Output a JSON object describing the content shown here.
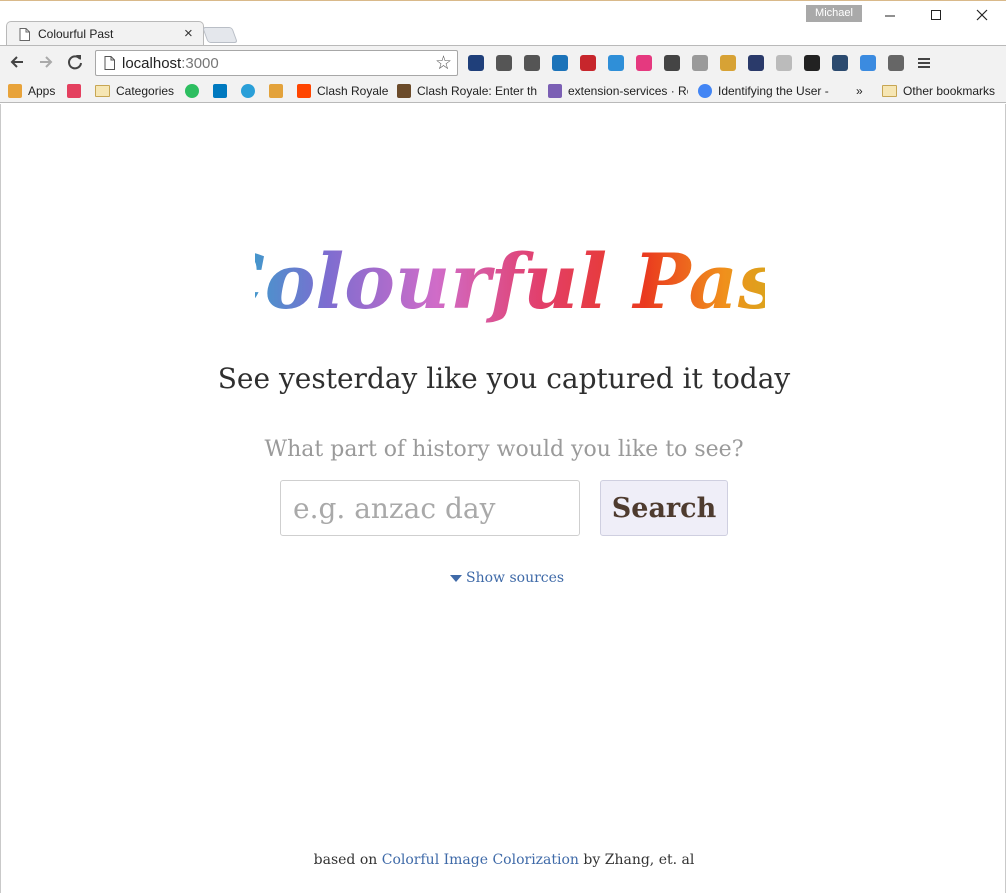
{
  "browser": {
    "tab_title": "Colourful Past",
    "profile_name": "Michael",
    "url_host": "localhost",
    "url_port": ":3000",
    "extensions": [
      {
        "icon": "onedrive-icon",
        "color": "#1f3f7a"
      },
      {
        "icon": "pocket-icon",
        "color": "#555555"
      },
      {
        "icon": "cast-icon",
        "color": "#555555"
      },
      {
        "icon": "quotes-icon",
        "color": "#1c73b9"
      },
      {
        "icon": "lastpass-icon",
        "color": "#c7262c"
      },
      {
        "icon": "checker-icon",
        "color": "#2f8fd8"
      },
      {
        "icon": "docs-icon",
        "color": "#e5397f"
      },
      {
        "icon": "tree-icon",
        "color": "#444444"
      },
      {
        "icon": "drive-icon",
        "color": "#9a9a9a"
      },
      {
        "icon": "note-icon",
        "color": "#d7a235"
      },
      {
        "icon": "infinity-icon",
        "color": "#2a3a6a"
      },
      {
        "icon": "people-icon",
        "color": "#bbbbbb"
      },
      {
        "icon": "edge-icon",
        "color": "#222222"
      },
      {
        "icon": "ptt-icon",
        "color": "#2b4a6f"
      },
      {
        "icon": "magnifier-icon",
        "color": "#3b8be0"
      },
      {
        "icon": "target-icon",
        "color": "#666666"
      }
    ],
    "bookmarks": [
      {
        "label": "Apps",
        "icon": "apps-icon"
      },
      {
        "label": "",
        "icon": "pocket-icon"
      },
      {
        "label": "Categories",
        "icon": "folder-icon"
      },
      {
        "label": "",
        "icon": "evernote-icon"
      },
      {
        "label": "",
        "icon": "trello-icon"
      },
      {
        "label": "",
        "icon": "search-site-icon"
      },
      {
        "label": "",
        "icon": "rainbow-icon"
      },
      {
        "label": "Clash Royale",
        "icon": "reddit-icon"
      },
      {
        "label": "Clash Royale: Enter th",
        "icon": "game-icon"
      },
      {
        "label": "extension-services · Re",
        "icon": "heroku-icon"
      },
      {
        "label": "Identifying the User -",
        "icon": "chrome-icon"
      },
      {
        "label": "»",
        "icon": "more-icon"
      },
      {
        "label": "Other bookmarks",
        "icon": "folder-icon"
      }
    ]
  },
  "page": {
    "logo_text": "Colourful Past",
    "tagline": "See yesterday like you captured it today",
    "prompt": "What part of history would you like to see?",
    "search": {
      "placeholder": "e.g. anzac day",
      "value": "",
      "button_label": "Search"
    },
    "show_sources": "Show sources",
    "footer": {
      "prefix": "based on",
      "link_text": "Colorful Image Colorization",
      "suffix": "by Zhang, et. al"
    }
  }
}
